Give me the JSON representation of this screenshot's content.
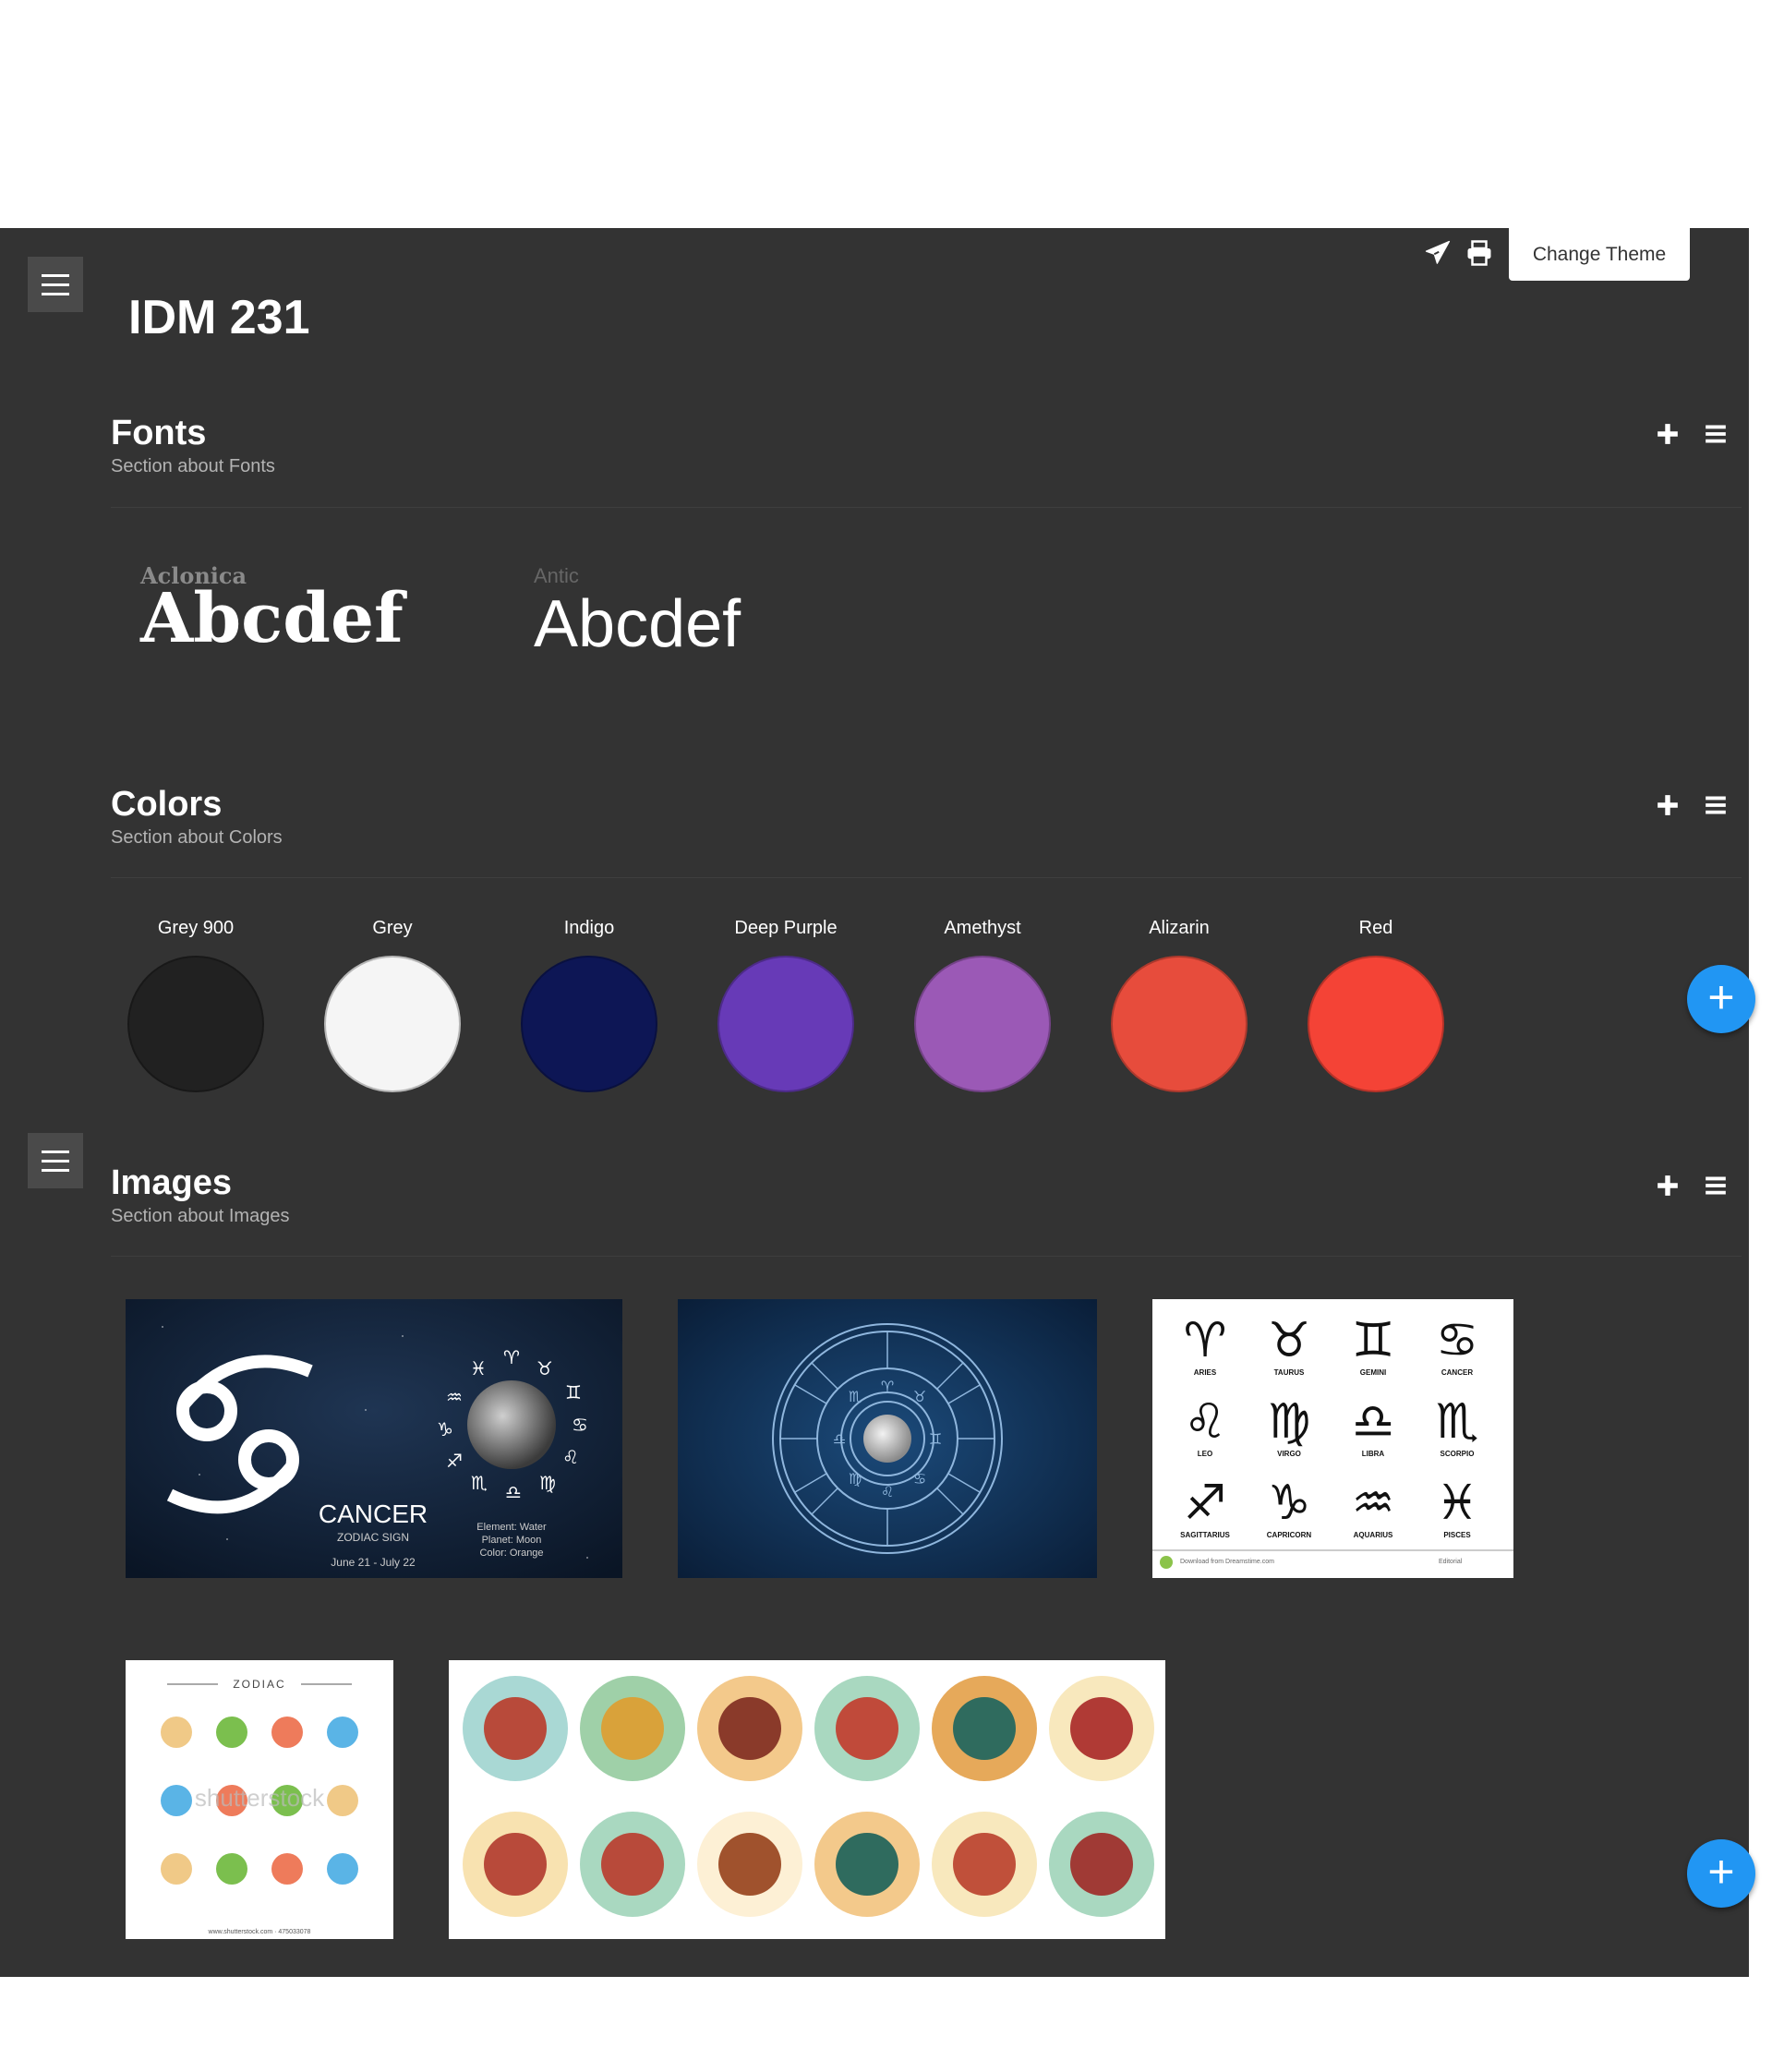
{
  "app": {
    "title": "IDM 231"
  },
  "header": {
    "send_icon": "paper-plane-icon",
    "print_icon": "printer-icon",
    "change_theme_label": "Change Theme"
  },
  "sections": {
    "fonts": {
      "title": "Fonts",
      "subtitle": "Section about Fonts",
      "samples": [
        {
          "name": "Aclonica",
          "sample": "Abcdef"
        },
        {
          "name": "Antic",
          "sample": "Abcdef"
        }
      ]
    },
    "colors": {
      "title": "Colors",
      "subtitle": "Section about Colors",
      "swatches": [
        {
          "name": "Grey 900",
          "hex": "#212121"
        },
        {
          "name": "Grey",
          "hex": "#f5f5f5"
        },
        {
          "name": "Indigo",
          "hex": "#0d1655"
        },
        {
          "name": "Deep Purple",
          "hex": "#673ab7"
        },
        {
          "name": "Amethyst",
          "hex": "#9b59b6"
        },
        {
          "name": "Alizarin",
          "hex": "#e74c3c"
        },
        {
          "name": "Red",
          "hex": "#f44336"
        }
      ]
    },
    "images": {
      "title": "Images",
      "subtitle": "Section about Images",
      "cancer_card": {
        "title": "CANCER",
        "subtitle": "ZODIAC SIGN",
        "dates": "June 21 - July 22",
        "element": "Element: Water",
        "planet": "Planet: Moon",
        "color": "Color: Orange"
      },
      "symbols_card": {
        "signs": [
          "ARIES",
          "TAURUS",
          "GEMINI",
          "CANCER",
          "LEO",
          "VIRGO",
          "LIBRA",
          "SCORPIO",
          "SAGITTARIUS",
          "CAPRICORN",
          "AQUARIUS",
          "PISCES"
        ],
        "footer_left": "Download from Dreamstime.com",
        "footer_right": "Editorial"
      },
      "zodiac_card": {
        "heading": "ZODIAC",
        "watermark": "shutterstock",
        "footer": "www.shutterstock.com · 475033078"
      }
    }
  },
  "section_icons": {
    "add": "plus-icon",
    "menu": "hamburger-icon"
  },
  "fab_icon": "plus-icon",
  "colors": {
    "panel_bg": "#333333",
    "fab": "#2196f3"
  }
}
